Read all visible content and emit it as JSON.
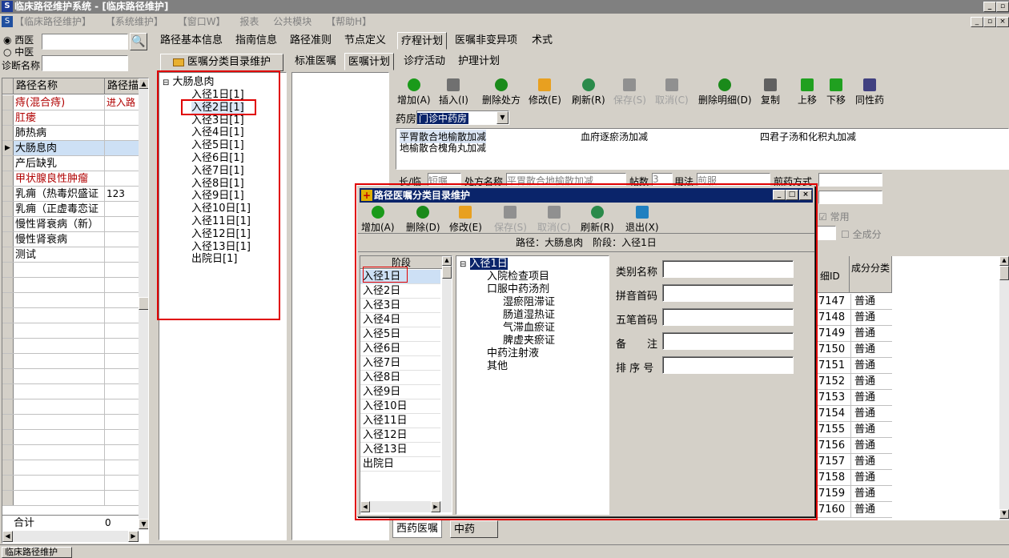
{
  "window": {
    "title": "临床路径维护系统 - [临床路径维护]"
  },
  "menu": [
    "【临床路径维护】",
    "【系统维护】",
    "【窗口W】",
    "报表",
    "公共模块",
    "【帮助H】"
  ],
  "left": {
    "radio_west": "西医",
    "radio_chinese": "中医",
    "diag_label": "诊断名称",
    "col_name": "路径名称",
    "col_path": "路径描",
    "rows": [
      {
        "name": "痔(混合痔)",
        "desc": "进入路",
        "red": true
      },
      {
        "name": "肛瘘",
        "desc": "",
        "red": true
      },
      {
        "name": "肺热病",
        "desc": "",
        "red": false
      },
      {
        "name": "大肠息肉",
        "desc": "",
        "red": false,
        "selected": true
      },
      {
        "name": "产后缺乳",
        "desc": "",
        "red": false
      },
      {
        "name": "甲状腺良性肿瘤",
        "desc": "",
        "red": true
      },
      {
        "name": "乳痈（热毒炽盛证",
        "desc": "123",
        "red": false
      },
      {
        "name": "乳痈（正虚毒恋证",
        "desc": "",
        "red": false
      },
      {
        "name": "慢性肾衰病（新）",
        "desc": "",
        "red": false
      },
      {
        "name": "慢性肾衰病",
        "desc": "",
        "red": false
      },
      {
        "name": "测试",
        "desc": "",
        "red": false
      }
    ],
    "total_label": "合计",
    "total_value": "0"
  },
  "main_tabs": [
    "路径基本信息",
    "指南信息",
    "路径准则",
    "节点定义",
    "疗程计划",
    "医嘱非变异项",
    "术式"
  ],
  "catalog_button": "医嘱分类目录维护",
  "tree": {
    "root": "大肠息肉",
    "nodes": [
      "入径1日[1]",
      "入径2日[1]",
      "入径3日[1]",
      "入径4日[1]",
      "入径5日[1]",
      "入径6日[1]",
      "入径7日[1]",
      "入径8日[1]",
      "入径9日[1]",
      "入径10日[1]",
      "入径11日[1]",
      "入径12日[1]",
      "入径13日[1]",
      "出院日[1]"
    ]
  },
  "sub_tabs": [
    "标准医嘱",
    "医嘱计划",
    "诊疗活动",
    "护理计划"
  ],
  "toolbar": [
    {
      "label": "增加(A)",
      "icon": "add-icon",
      "disabled": false
    },
    {
      "label": "插入(I)",
      "icon": "insert-icon",
      "disabled": false
    },
    {
      "label": "删除处方",
      "icon": "delete-prescription-icon",
      "disabled": false
    },
    {
      "label": "修改(E)",
      "icon": "edit-icon",
      "disabled": false
    },
    {
      "label": "刷新(R)",
      "icon": "refresh-icon",
      "disabled": false
    },
    {
      "label": "保存(S)",
      "icon": "save-icon",
      "disabled": true
    },
    {
      "label": "取消(C)",
      "icon": "cancel-icon",
      "disabled": true
    },
    {
      "label": "删除明细(D)",
      "icon": "delete-detail-icon",
      "disabled": false
    },
    {
      "label": "复制",
      "icon": "copy-icon",
      "disabled": false
    },
    {
      "label": "上移",
      "icon": "up-arrow-icon",
      "disabled": false
    },
    {
      "label": "下移",
      "icon": "down-arrow-icon",
      "disabled": false
    },
    {
      "label": "同性药",
      "icon": "same-drug-icon",
      "disabled": false
    }
  ],
  "pharmacy": {
    "label": "药房",
    "value": "门诊中药房"
  },
  "prescriptions": [
    "平胃散合地榆散加减",
    "血府逐瘀汤加减",
    "四君子汤和化积丸加减",
    "地榆散合槐角丸加减"
  ],
  "form": {
    "type_label": "长/临",
    "type_value": "短嘱",
    "rx_label": "处方名称",
    "rx_value": "平胃散合地榆散加减",
    "dose_label": "帖数",
    "dose_value": "3",
    "usage_label": "用法",
    "usage_value": "煎服",
    "decoct_label": "煎药方式",
    "common_label": "常用",
    "all_label": "全成分"
  },
  "grid": {
    "col_id": "细ID",
    "col_type": "成分分类",
    "rows": [
      {
        "id": "7147",
        "type": "普通"
      },
      {
        "id": "7148",
        "type": "普通"
      },
      {
        "id": "7149",
        "type": "普通"
      },
      {
        "id": "7150",
        "type": "普通"
      },
      {
        "id": "7151",
        "type": "普通"
      },
      {
        "id": "7152",
        "type": "普通"
      },
      {
        "id": "7153",
        "type": "普通"
      },
      {
        "id": "7154",
        "type": "普通"
      },
      {
        "id": "7155",
        "type": "普通"
      },
      {
        "id": "7156",
        "type": "普通"
      },
      {
        "id": "7157",
        "type": "普通"
      },
      {
        "id": "7158",
        "type": "普通"
      },
      {
        "id": "7159",
        "type": "普通"
      },
      {
        "id": "7160",
        "type": "普通"
      }
    ]
  },
  "bottom_tabs": [
    "西药医嘱",
    "中药"
  ],
  "status": "临床路径维护",
  "dialog": {
    "title": "路径医嘱分类目录维护",
    "toolbar": [
      {
        "label": "增加(A)",
        "icon": "add-icon",
        "disabled": false
      },
      {
        "label": "删除(D)",
        "icon": "delete-icon",
        "disabled": false
      },
      {
        "label": "修改(E)",
        "icon": "edit-icon",
        "disabled": false
      },
      {
        "label": "保存(S)",
        "icon": "save-icon",
        "disabled": true
      },
      {
        "label": "取消(C)",
        "icon": "cancel-icon",
        "disabled": true
      },
      {
        "label": "刷新(R)",
        "icon": "refresh-icon",
        "disabled": false
      },
      {
        "label": "退出(X)",
        "icon": "exit-icon",
        "disabled": false
      }
    ],
    "info": "路径：大肠息肉　阶段：入径1日",
    "stage_header": "阶段",
    "stages": [
      "入径1日",
      "入径2日",
      "入径3日",
      "入径4日",
      "入径5日",
      "入径6日",
      "入径7日",
      "入径8日",
      "入径9日",
      "入径10日",
      "入径11日",
      "入径12日",
      "入径13日",
      "出院日"
    ],
    "tree_root": "入径1日",
    "tree_items": [
      {
        "label": "入院检查项目",
        "level": 1
      },
      {
        "label": "口服中药汤剂",
        "level": 1
      },
      {
        "label": "湿瘀阻滞证",
        "level": 2
      },
      {
        "label": "肠道湿热证",
        "level": 2
      },
      {
        "label": "气滞血瘀证",
        "level": 2
      },
      {
        "label": "脾虚夹瘀证",
        "level": 2
      },
      {
        "label": "中药注射液",
        "level": 1
      },
      {
        "label": "其他",
        "level": 1
      }
    ],
    "fields": [
      "类别名称",
      "拼音首码",
      "五笔首码",
      "备　　注",
      "排 序 号"
    ]
  }
}
